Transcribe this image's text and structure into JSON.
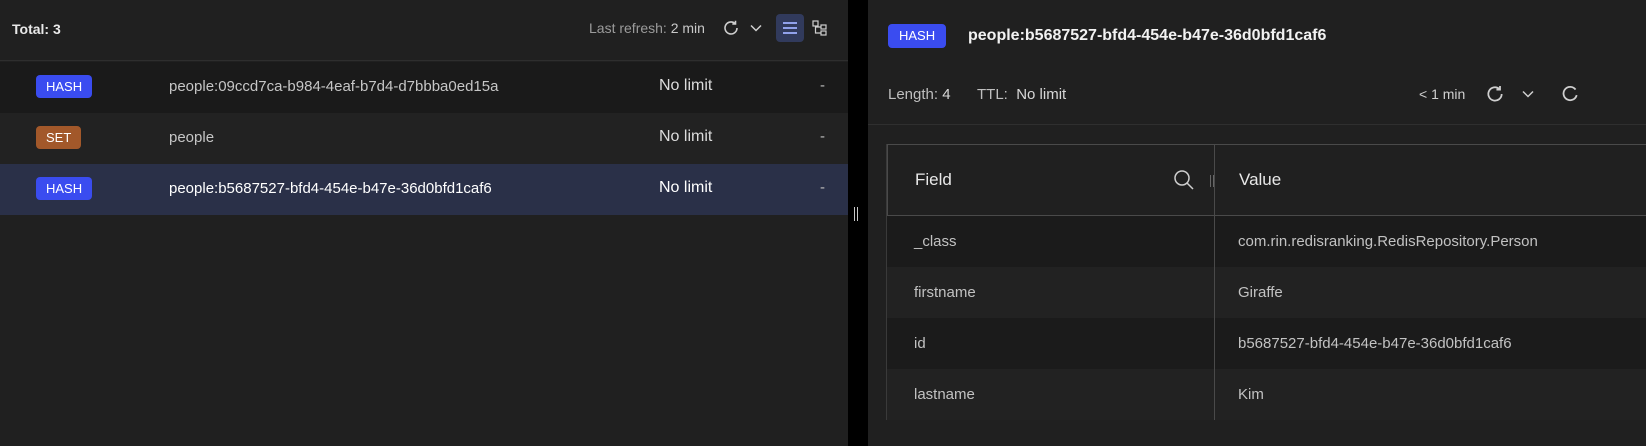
{
  "key_list": {
    "total_label": "Total: 3",
    "refresh_label": "Last refresh:",
    "refresh_value": "2 min",
    "keys": [
      {
        "type": "HASH",
        "name": "people:09ccd7ca-b984-4eaf-b7d4-d7bbba0ed15a",
        "ttl": "No limit",
        "size": "-"
      },
      {
        "type": "SET",
        "name": "people",
        "ttl": "No limit",
        "size": "-"
      },
      {
        "type": "HASH",
        "name": "people:b5687527-bfd4-454e-b47e-36d0bfd1caf6",
        "ttl": "No limit",
        "size": "-"
      }
    ],
    "selected_index": 2
  },
  "detail": {
    "type": "HASH",
    "key_name": "people:b5687527-bfd4-454e-b47e-36d0bfd1caf6",
    "length_label": "Length:",
    "length_value": "4",
    "ttl_label": "TTL:",
    "ttl_value": "No limit",
    "last_refresh": "< 1 min",
    "columns": {
      "field": "Field",
      "value": "Value"
    },
    "fields": [
      {
        "field": "_class",
        "value": "com.rin.redisranking.RedisRepository.Person"
      },
      {
        "field": "firstname",
        "value": "Giraffe"
      },
      {
        "field": "id",
        "value": "b5687527-bfd4-454e-b47e-36d0bfd1caf6"
      },
      {
        "field": "lastname",
        "value": "Kim"
      }
    ]
  },
  "colors": {
    "hash_badge": "#3a4cf0",
    "set_badge": "#a2582a",
    "selected_row": "#2a3048",
    "panel_bg": "#202020"
  },
  "icons": [
    "refresh-icon",
    "chevron-down-icon",
    "list-view-icon",
    "tree-view-icon",
    "search-icon",
    "resize-handle-icon"
  ]
}
